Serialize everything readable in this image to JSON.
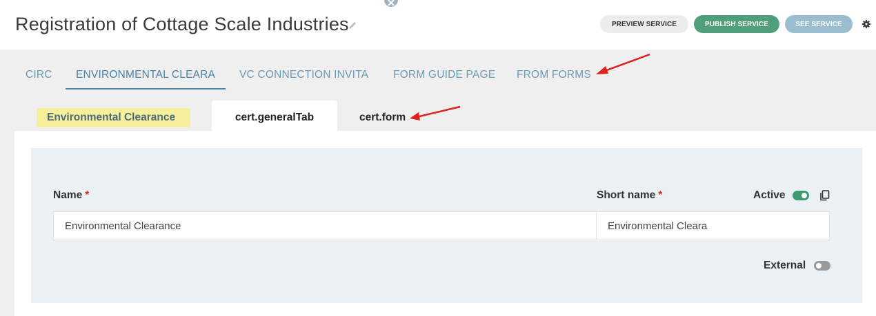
{
  "header": {
    "title": "Registration of Cottage Scale Industries",
    "buttons": {
      "preview": "PREVIEW SERVICE",
      "publish": "PUBLISH SERVICE",
      "see": "SEE SERVICE"
    }
  },
  "top_tabs": [
    "CIRC",
    "ENVIRONMENTAL CLEARA",
    "VC CONNECTION INVITA",
    "FORM GUIDE PAGE",
    "FROM FORMS"
  ],
  "sub_tabs": {
    "language": "Environmental Clearance",
    "general": "cert.generalTab",
    "form": "cert.form"
  },
  "form": {
    "name_label": "Name",
    "required_mark": "*",
    "name_value": "Environmental Clearance",
    "short_name_label": "Short name",
    "short_name_value": "Environmental Cleara",
    "active_label": "Active",
    "active_on": true,
    "external_label": "External",
    "external_on": false
  },
  "colors": {
    "accent": "#4a82a8",
    "publish": "#4f9f7c",
    "see_service": "#9bbdd0",
    "annotation_arrow": "#e0201c",
    "highlight": "#f7ee9c"
  }
}
